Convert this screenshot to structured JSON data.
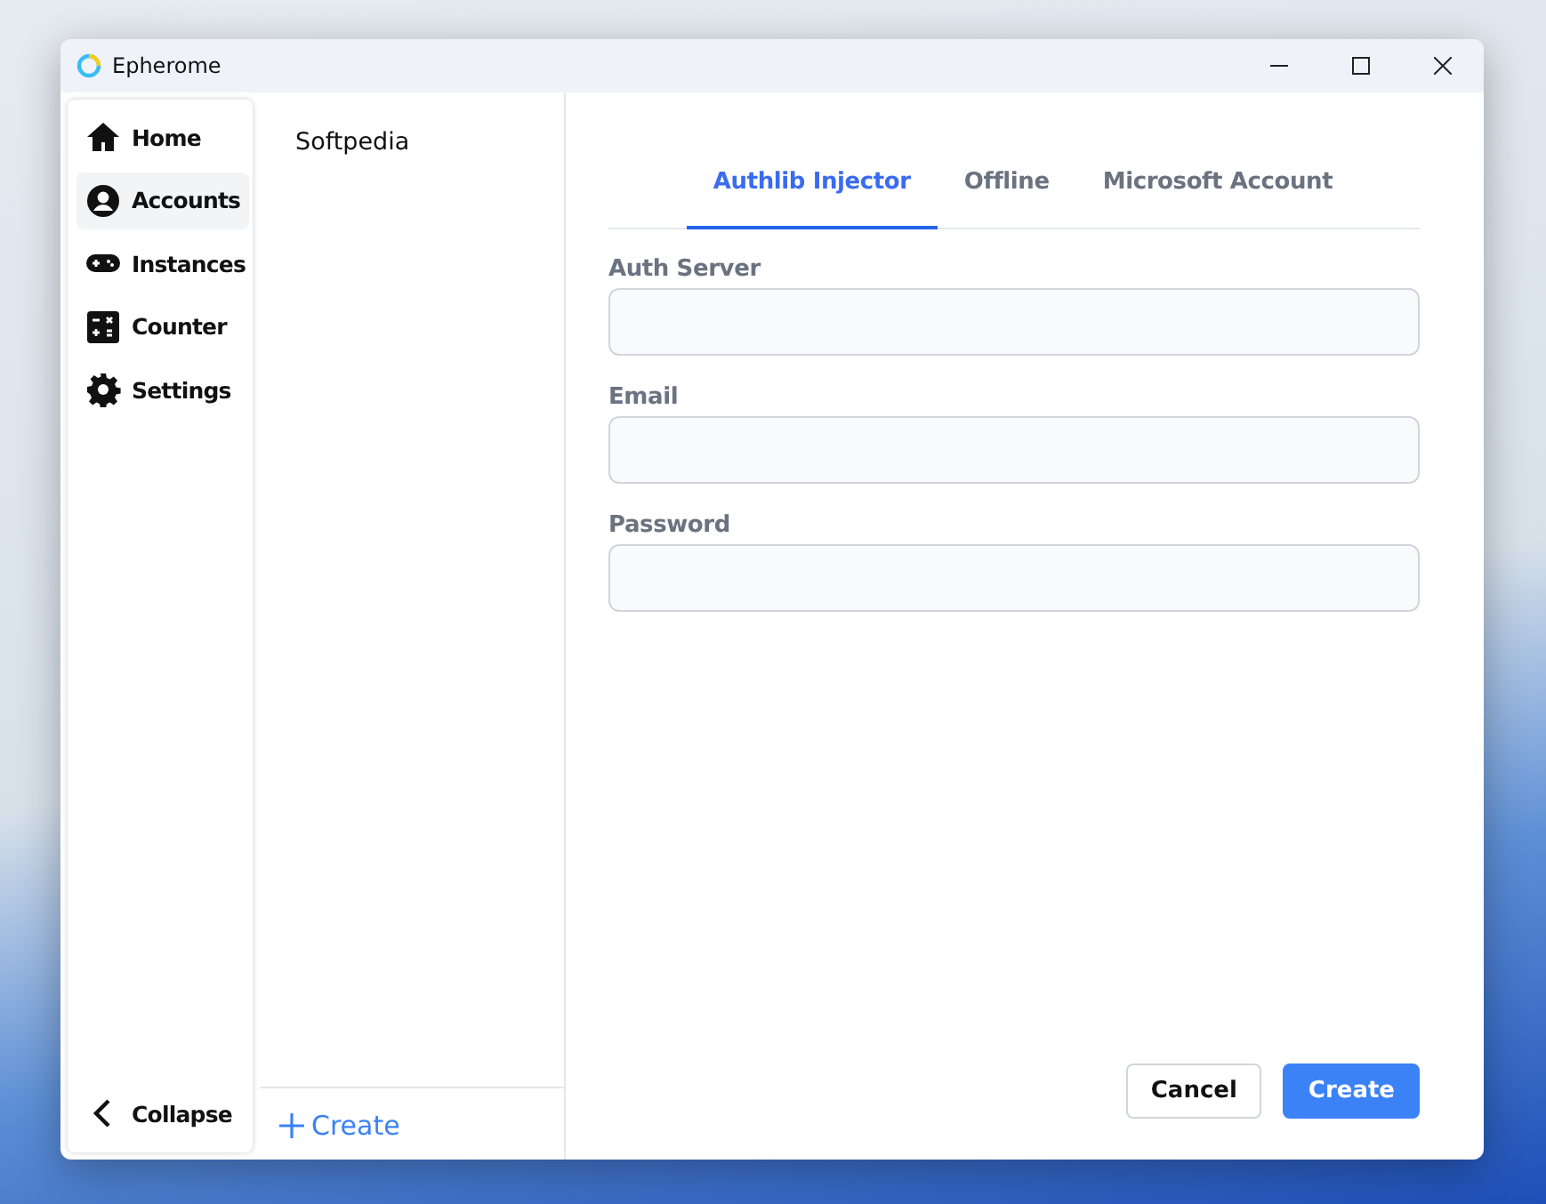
{
  "window": {
    "title": "Epherome"
  },
  "sidebar": {
    "items": [
      {
        "label": "Home",
        "selected": false
      },
      {
        "label": "Accounts",
        "selected": true
      },
      {
        "label": "Instances",
        "selected": false
      },
      {
        "label": "Counter",
        "selected": false
      },
      {
        "label": "Settings",
        "selected": false
      }
    ],
    "collapse": "Collapse"
  },
  "accounts": {
    "items": [
      {
        "name": "Softpedia"
      }
    ],
    "create": "Create"
  },
  "form": {
    "tabs": [
      {
        "label": "Authlib Injector",
        "selected": true
      },
      {
        "label": "Offline",
        "selected": false
      },
      {
        "label": "Microsoft Account",
        "selected": false
      }
    ],
    "fields": [
      {
        "label": "Auth Server"
      },
      {
        "label": "Email"
      },
      {
        "label": "Password"
      }
    ],
    "buttons": [
      {
        "label": "Cancel",
        "kind": "secondary"
      },
      {
        "label": "Create",
        "kind": "primary"
      }
    ]
  }
}
